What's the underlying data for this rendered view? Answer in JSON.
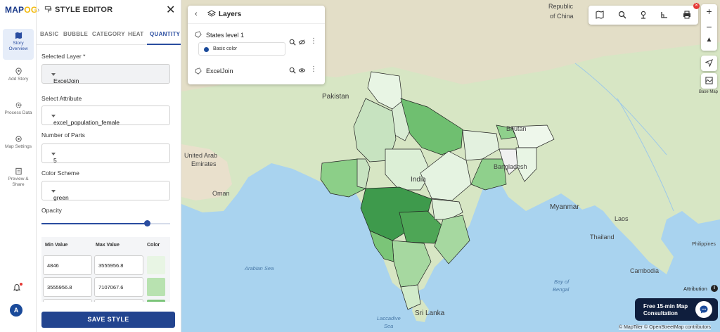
{
  "brand": {
    "logo_left": "MAP",
    "logo_right": "OG"
  },
  "rail": {
    "items": [
      {
        "label": "Story Overview"
      },
      {
        "label": "Add Story"
      },
      {
        "label": "Process Data"
      },
      {
        "label": "Map Settings"
      },
      {
        "label": "Preview & Share"
      }
    ],
    "avatar_initial": "A"
  },
  "editor": {
    "title": "STYLE EDITOR",
    "tabs": [
      "BASIC",
      "BUBBLE",
      "CATEGORY",
      "HEAT",
      "QUANTITY"
    ],
    "active_tab": "QUANTITY",
    "selected_layer_label": "Selected Layer *",
    "selected_layer_value": "ExcelJoin",
    "attribute_label": "Select Attribute",
    "attribute_value": "excel_population_female",
    "parts_label": "Number of Parts",
    "parts_value": "5",
    "scheme_label": "Color Scheme",
    "scheme_value": "green",
    "opacity_label": "Opacity",
    "opacity_level": 0.82,
    "table": {
      "headers": [
        "Min Value",
        "Max Value",
        "Color"
      ],
      "rows": [
        {
          "min": "4846",
          "max": "3555956.8",
          "color": "#e8f5e4"
        },
        {
          "min": "3555956.8",
          "max": "7107067.6",
          "color": "#b8e2b0"
        },
        {
          "min": "",
          "max": "",
          "color": "#7cc47a"
        }
      ]
    },
    "save_label": "SAVE STYLE"
  },
  "layers_panel": {
    "title": "Layers",
    "layers": [
      {
        "name": "States level 1",
        "chip": "Basic color"
      },
      {
        "name": "ExcelJoin"
      }
    ]
  },
  "map": {
    "labels": [
      {
        "text": "Republic"
      },
      {
        "text": "of China"
      },
      {
        "text": "Pakistan"
      },
      {
        "text": "United Arab"
      },
      {
        "text": "Emirates"
      },
      {
        "text": "Oman"
      },
      {
        "text": "Bhutan"
      },
      {
        "text": "Bangladesh"
      },
      {
        "text": "India"
      },
      {
        "text": "Myanmar"
      },
      {
        "text": "Laos"
      },
      {
        "text": "Thailand"
      },
      {
        "text": "Cambodia"
      },
      {
        "text": "Sri Lanka"
      },
      {
        "text": "Arabian Sea"
      },
      {
        "text": "Bay of"
      },
      {
        "text": "Bengal"
      },
      {
        "text": "Laccadive"
      },
      {
        "text": "Sea"
      },
      {
        "text": "Philippines"
      }
    ],
    "attribution": "Attribution",
    "basemap_label": "Base Map",
    "consult_text": "Free 15-min Map Consultation",
    "copyright": "© MapTiler © OpenStreetMap contributors"
  },
  "colors": {
    "accent": "#2a4da0",
    "save_button": "#22448f",
    "consult_bg": "#0f1e3d"
  }
}
